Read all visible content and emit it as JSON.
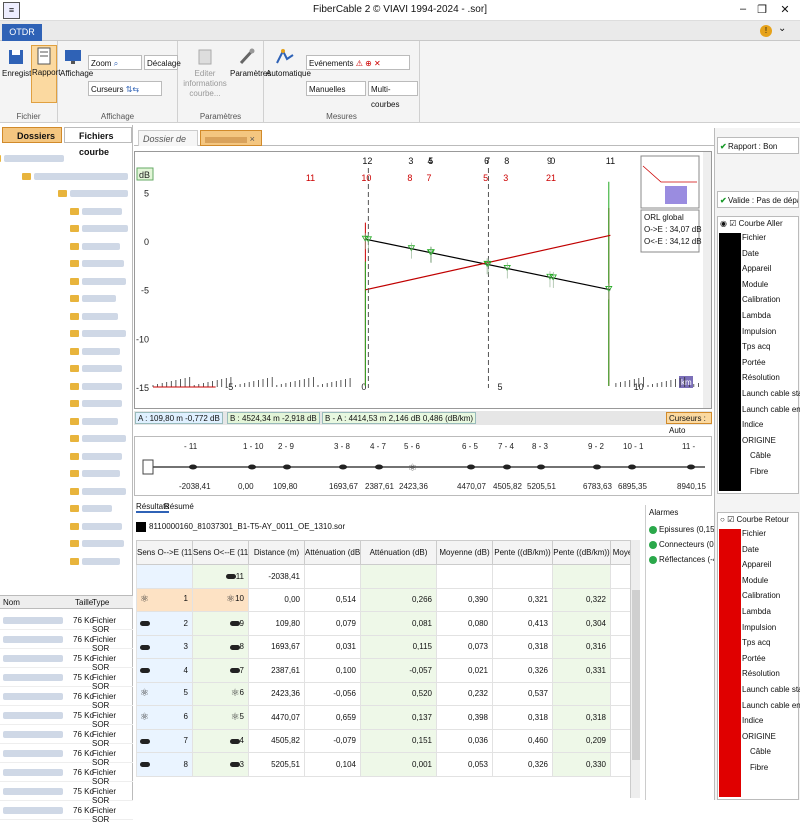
{
  "window": {
    "title": "FiberCable 2 © VIAVI 1994-2024 - .sor]",
    "minimize": "–",
    "restore": "❐",
    "close": "✕"
  },
  "app_tab": "OTDR",
  "ribbon": {
    "fichier": {
      "label": "Fichier",
      "enregistrer": "Enregistrer",
      "rapport": "Rapport"
    },
    "affichage": {
      "label": "Affichage",
      "affichage_btn": "Affichage",
      "zoom": "Zoom",
      "curseurs": "Curseurs",
      "decalage": "Décalage"
    },
    "parametres": {
      "label": "Paramètres",
      "editer": "Editer informations courbe...",
      "parametres_btn": "Paramètres"
    },
    "mesures": {
      "label": "Mesures",
      "automatique": "Automatique",
      "evenements": "Evénements",
      "manuelles": "Manuelles",
      "multicourbes": "Multi-courbes"
    }
  },
  "left": {
    "tab_dossiers": "Dossiers",
    "tab_fichiers": "Fichiers courbe",
    "files_cols": {
      "nom": "Nom",
      "taille": "Taille",
      "type": "Type"
    },
    "files": [
      {
        "size": "76 Ko",
        "type": "Fichier SOR"
      },
      {
        "size": "76 Ko",
        "type": "Fichier SOR"
      },
      {
        "size": "75 Ko",
        "type": "Fichier SOR"
      },
      {
        "size": "75 Ko",
        "type": "Fichier SOR"
      },
      {
        "size": "76 Ko",
        "type": "Fichier SOR"
      },
      {
        "size": "75 Ko",
        "type": "Fichier SOR"
      },
      {
        "size": "76 Ko",
        "type": "Fichier SOR"
      },
      {
        "size": "76 Ko",
        "type": "Fichier SOR"
      },
      {
        "size": "76 Ko",
        "type": "Fichier SOR"
      },
      {
        "size": "75 Ko",
        "type": "Fichier SOR"
      },
      {
        "size": "76 Ko",
        "type": "Fichier SOR"
      }
    ]
  },
  "doc_tab": "Dossier de mesure",
  "doc_close": "×",
  "chart_data": {
    "type": "line",
    "ylabel": "dB",
    "xlabel": "km",
    "y_ticks": [
      "5",
      "0",
      "-5",
      "-10",
      "-15"
    ],
    "x_ticks": [
      "-5",
      "0",
      "5",
      "10"
    ],
    "ylim": [
      -15,
      7
    ],
    "xlim": [
      -7.8,
      12.4
    ],
    "series": [
      {
        "color": "#000000",
        "x": [
          0,
          9
        ],
        "y": [
          0.3,
          -4.9
        ]
      },
      {
        "color": "#c00000",
        "x": [
          0,
          9
        ],
        "y": [
          -4.9,
          0.7
        ]
      }
    ],
    "marker_numbers_top": [
      "12",
      "3",
      "4",
      "5",
      "6",
      "7",
      "8",
      "9",
      "0",
      "11"
    ],
    "marker_numbers_red": [
      "11",
      "10",
      "8",
      "7",
      "5",
      "3",
      "21"
    ],
    "markers_red_x": [
      -2.04,
      0,
      1.69,
      2.39,
      4.47,
      5.21,
      6.78
    ],
    "events_x": [
      0,
      0.11,
      1.69,
      2.39,
      2.42,
      4.47,
      4.51,
      5.21,
      6.78,
      6.9,
      8.94
    ],
    "orl": {
      "title": "ORL global",
      "oe": "O->E : 34,07 dB",
      "eo": "O<-E : 34,12 dB"
    }
  },
  "cursors": {
    "a": "A : 109,80 m  -0,772 dB",
    "b": "B : 4524,34 m  -2,918 dB",
    "ba": "B - A : 4414,53 m   2,146 dB  0,486 (dB/km)",
    "mode": "Curseurs : Auto"
  },
  "linkmap": {
    "top": [
      "- 11",
      "1 - 10",
      "2 - 9",
      "3 - 8",
      "4 - 7",
      "5 - 6",
      "6 - 5",
      "7 - 4",
      "8 - 3",
      "9 - 2",
      "10 - 1",
      "11 -"
    ],
    "bottom": [
      "-2038,41",
      "0,00",
      "109,80",
      "1693,67",
      "2387,61",
      "2423,36",
      "4470,07",
      "4505,82",
      "5205,51",
      "6783,63",
      "6895,35",
      "8940,15"
    ]
  },
  "results": {
    "tab_resultats": "Résultats",
    "tab_resume": "Résumé",
    "file": "8110000160_81037301_B1-T5-AY_0011_OE_1310.sor",
    "headers": [
      "Sens O-->E (11)",
      "Sens O<--E (11)",
      "Distance (m)",
      "Atténuation (dB)",
      "Atténuation (dB)",
      "Moyenne (dB)",
      "Pente ((dB/km))",
      "Pente ((dB/km))",
      "Moye"
    ],
    "rows": [
      {
        "n1": "",
        "n2": "11",
        "dist": "-2038,41",
        "att1": "",
        "att2": "",
        "moy": "",
        "p1": "",
        "p2": ""
      },
      {
        "n1": "1",
        "n2": "10",
        "dist": "0,00",
        "att1": "0,514",
        "att2": "0,266",
        "moy": "0,390",
        "p1": "0,321",
        "p2": "0,322"
      },
      {
        "n1": "2",
        "n2": "9",
        "dist": "109,80",
        "att1": "0,079",
        "att2": "0,081",
        "moy": "0,080",
        "p1": "0,413",
        "p2": "0,304"
      },
      {
        "n1": "3",
        "n2": "8",
        "dist": "1693,67",
        "att1": "0,031",
        "att2": "0,115",
        "moy": "0,073",
        "p1": "0,318",
        "p2": "0,316"
      },
      {
        "n1": "4",
        "n2": "7",
        "dist": "2387,61",
        "att1": "0,100",
        "att2": "-0,057",
        "moy": "0,021",
        "p1": "0,326",
        "p2": "0,331"
      },
      {
        "n1": "5",
        "n2": "6",
        "dist": "2423,36",
        "att1": "-0,056",
        "att2": "0,520",
        "moy": "0,232",
        "p1": "0,537",
        "p2": ""
      },
      {
        "n1": "6",
        "n2": "5",
        "dist": "4470,07",
        "att1": "0,659",
        "att2": "0,137",
        "moy": "0,398",
        "p1": "0,318",
        "p2": "0,318"
      },
      {
        "n1": "7",
        "n2": "4",
        "dist": "4505,82",
        "att1": "-0,079",
        "att2": "0,151",
        "moy": "0,036",
        "p1": "0,460",
        "p2": "0,209"
      },
      {
        "n1": "8",
        "n2": "3",
        "dist": "5205,51",
        "att1": "0,104",
        "att2": "0,001",
        "moy": "0,053",
        "p1": "0,326",
        "p2": "0,330"
      }
    ]
  },
  "alarms": {
    "title": "Alarmes",
    "items": [
      "Epissures (0,150 dB)",
      "Connecteurs (0,600 dB)",
      "Réflectances (-40,00 dB)"
    ]
  },
  "right": {
    "rapport": "Rapport : Bon",
    "valide": "Valide : Pas de dépassement",
    "aller": {
      "title": "Courbe Aller",
      "color": "#000000"
    },
    "retour": {
      "title": "Courbe Retour",
      "color": "#e00000"
    },
    "props": [
      "Fichier",
      "Date",
      "Appareil",
      "Module",
      "Calibration",
      "Lambda",
      "Impulsion",
      "Tps acq",
      "Portée",
      "Résolution",
      "Launch cable start",
      "Launch cable end",
      "Indice",
      "ORIGINE",
      "Câble",
      "Fibre"
    ]
  },
  "colors": {
    "accent": "#2f62b6",
    "selected_tab": "#f4c680",
    "green": "#1a9a2a",
    "red": "#c00000"
  }
}
